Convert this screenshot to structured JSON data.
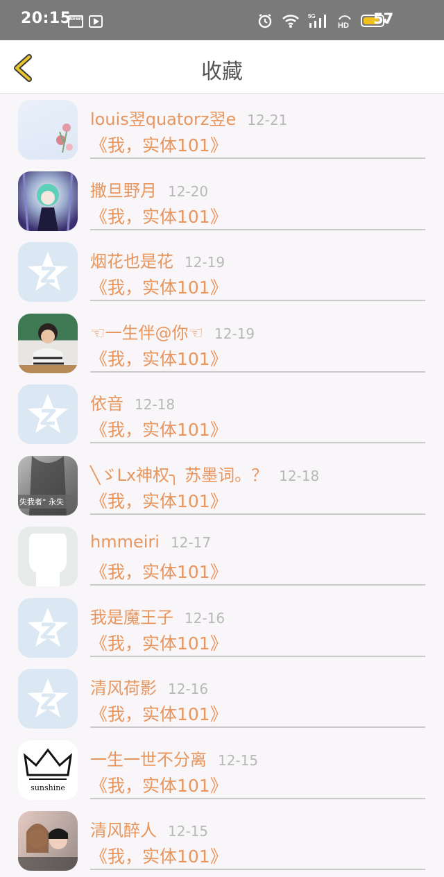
{
  "status_bar": {
    "time": "20:15",
    "news_icon_text": "NEWS",
    "battery_level": "57",
    "network": "5G"
  },
  "nav": {
    "title": "收藏"
  },
  "items": [
    {
      "name": "louis翌quatorz翌e",
      "date": "12-21",
      "work": "《我，实体101》",
      "avatar": "flower"
    },
    {
      "name": "撒旦野月",
      "date": "12-20",
      "work": "《我，实体101》",
      "avatar": "anime"
    },
    {
      "name": "烟花也是花",
      "date": "12-19",
      "work": "《我，实体101》",
      "avatar": "qq"
    },
    {
      "name": "☜一生伴@你☜",
      "date": "12-19",
      "work": "《我，实体101》",
      "avatar": "boy"
    },
    {
      "name": "依音",
      "date": "12-18",
      "work": "《我，实体101》",
      "avatar": "qq"
    },
    {
      "name": "╲ゞLx神权╮ 苏墨词。？",
      "date": "12-18",
      "work": "《我，实体101》",
      "avatar": "coat",
      "avatar_text": "失我者° 永失"
    },
    {
      "name": "hmmeiri",
      "date": "12-17",
      "work": "《我，实体101》",
      "avatar": "white"
    },
    {
      "name": "我是魔王子",
      "date": "12-16",
      "work": "《我，实体101》",
      "avatar": "qq"
    },
    {
      "name": "清风荷影",
      "date": "12-16",
      "work": "《我，实体101》",
      "avatar": "qq"
    },
    {
      "name": "一生一世不分离",
      "date": "12-15",
      "work": "《我，实体101》",
      "avatar": "crown",
      "avatar_text": "sunshine"
    },
    {
      "name": "清风醉人",
      "date": "12-15",
      "work": "《我，实体101》",
      "avatar": "couple"
    }
  ],
  "colors": {
    "accent": "#e8955e",
    "date": "#b8b8b8",
    "status_bar": "#7a7a7a",
    "back_arrow": "#e9c62e"
  }
}
